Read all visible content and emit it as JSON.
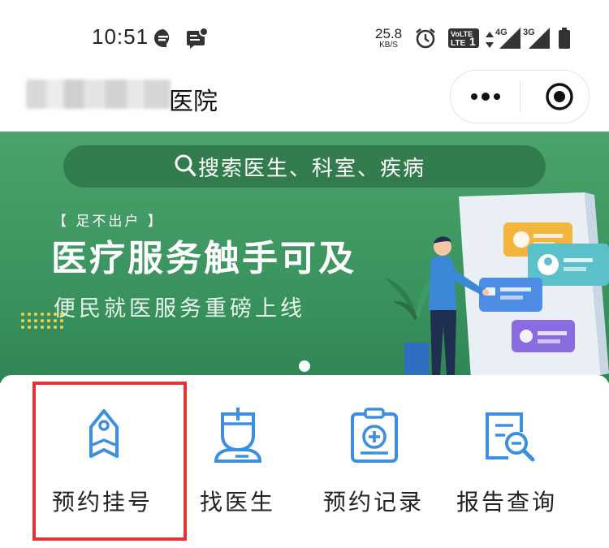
{
  "status_bar": {
    "time": "10:51",
    "net_speed": "25.8",
    "net_unit": "KB/S",
    "volte": "VoLTE1",
    "signal1": "4G",
    "signal2": "3G",
    "icons": [
      "message-icon",
      "notification-icon",
      "alarm-icon",
      "volte-icon",
      "data-arrows-icon",
      "signal-4g-icon",
      "signal-3g-icon",
      "battery-icon"
    ]
  },
  "nav": {
    "title": "医院",
    "capsule_icons": [
      "more-icon",
      "close-target-icon"
    ]
  },
  "banner": {
    "search_placeholder": "搜索医生、科室、疾病",
    "tag": "【 足不出户 】",
    "headline": "医疗服务触手可及",
    "subline": "便民就医服务重磅上线",
    "bg_color": "#3f9a63"
  },
  "menu": [
    {
      "label": "预约挂号",
      "icon": "registration-tag-icon",
      "highlighted": true
    },
    {
      "label": "找医生",
      "icon": "doctor-icon",
      "highlighted": false
    },
    {
      "label": "预约记录",
      "icon": "record-clipboard-icon",
      "highlighted": false
    },
    {
      "label": "报告查询",
      "icon": "report-search-icon",
      "highlighted": false
    }
  ],
  "colors": {
    "icon_blue": "#3c8ee0",
    "highlight_red": "#e0323a"
  }
}
